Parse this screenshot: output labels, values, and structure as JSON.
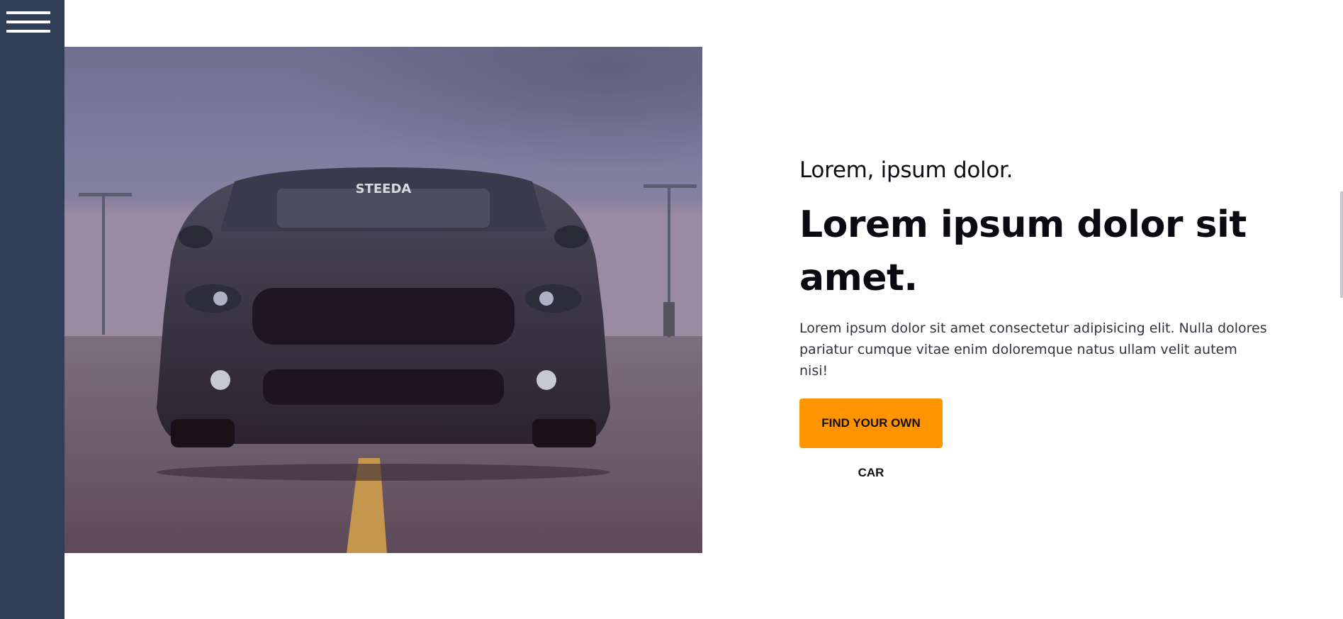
{
  "sidebar": {
    "menu_icon": "hamburger-menu-icon"
  },
  "hero": {
    "image_icon": "car-photo",
    "windshield_text": "STEEDA"
  },
  "content": {
    "subtitle": "Lorem, ipsum dolor.",
    "title": "Lorem ipsum dolor sit amet.",
    "body": "Lorem ipsum dolor sit amet consectetur adipisicing elit. Nulla dolores pariatur cumque vitae enim doloremque natus ullam velit autem nisi!",
    "cta_label": "FIND YOUR OWN CAR"
  },
  "colors": {
    "sidebar": "#323e57",
    "accent": "#fd9400",
    "text": "#0a0a10"
  }
}
